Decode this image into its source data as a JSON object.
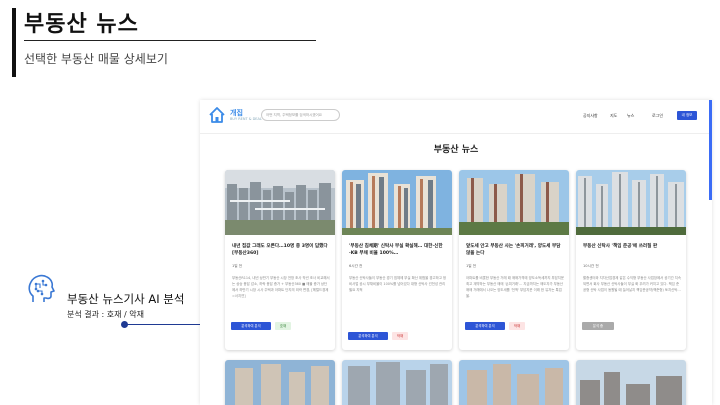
{
  "slide": {
    "title": "부동산 뉴스",
    "subtitle": "선택한 부동산 매물 상세보기"
  },
  "annotation": {
    "title": "부동산 뉴스기사 AI 분석",
    "subtitle": "분석 결과 : 호재 / 악재"
  },
  "site": {
    "logo": "개집",
    "logo_tagline": "BUY RENT & DEAL",
    "search_placeholder": "어떤 지역, 주택정보를 검색하시겠어요",
    "menu": [
      "공지사항",
      "지도",
      "뉴스",
      "로그인"
    ],
    "signup": "내 정보",
    "page_heading": "부동산 뉴스"
  },
  "colors": {
    "accent": "#2d55d6",
    "good": "#2e7d32",
    "bad": "#c62828"
  },
  "cards": [
    {
      "title": "내년 집값 그래도 오른다…10명 중 3명이 답했다 [부동산360]",
      "date": "1일 전",
      "body": "부동산R114, 내년 상반기 부동산 시장 전망 조사 작년 조사 비교해서는 상승 응답 감소, 하락 응답 증가 + 부동산360 ■ 매물 증가 상단에서 하반기 시장 시사 주택과 아파트 단지의 외곽 변경, [헤럴드경제=서지연]",
      "button": "분석하여 분석",
      "badge": "호재"
    },
    {
      "title": "'부동산 침체期' 신탁사 부실 확실해… 대한·신한·KB 부채 비율 100%…",
      "date": "6시간 전",
      "body": "부동산 신탁사들이 부동산 경기 침체에 부실 확산 위험을 경고하고 정비사업 공시 부채비율이 100%를 넘어섰다 대형 신탁사 건전성 관리 필요 지적",
      "button": "분석하여 분석",
      "badge": "악재"
    },
    {
      "title": "앞도세 안고 부동산 사는 '손피거래', 양도세 부담 않을 는다",
      "date": "1일 전",
      "body": "아파트를 비롯한 부동산 거래 때 매매가격에 양도소득세까지 부담지운 최고 계약하는 부동산 매매 '손피거래'… 지금까지는 매도자가 부동산 매매 거래에서 나오는 양도세를 '전액' 부담지운 이래 한 유자는 톡업을.",
      "button": "분석하여 분석",
      "badge": "악재"
    },
    {
      "title": "부동산 신탁사 '책임 준공'에 쓰러질 판",
      "date": "10시간 전",
      "body": "할증센터와 지자산업경제 같은 수익형 부동산 사업장에서 공기간 지속되면서 회사 부동산 신탁사들이 부실 화 우려가 커지고 있다. 책임 준공형 신탁 사업이 동원될 때 늘어날지 책임준공약(책준형) 토지신탁…",
      "button": "분석 중",
      "badge": ""
    }
  ],
  "icons": {
    "ai": "ai-brain-head-icon",
    "logo": "house-logo-icon"
  }
}
